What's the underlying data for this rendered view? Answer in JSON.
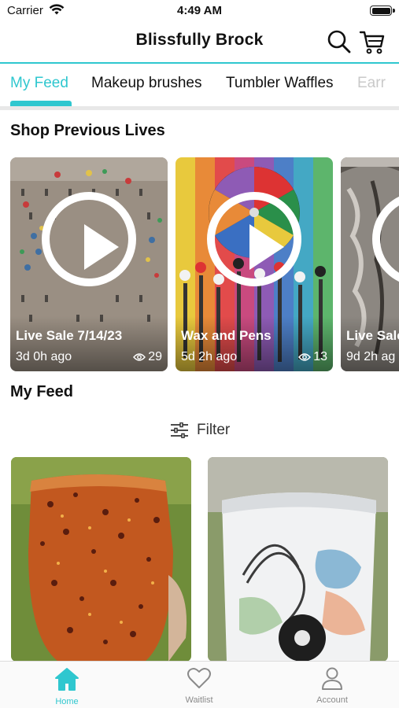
{
  "status_bar": {
    "carrier": "Carrier",
    "time": "4:49 AM"
  },
  "header": {
    "title": "Blissfully Brock"
  },
  "tabs": [
    {
      "label": "My Feed"
    },
    {
      "label": "Makeup brushes"
    },
    {
      "label": "Tumbler Waffles"
    },
    {
      "label": "Earr"
    }
  ],
  "previous_lives": {
    "title": "Shop Previous Lives",
    "items": [
      {
        "name": "Live Sale 7/14/23",
        "age": "3d 0h ago",
        "views": "29"
      },
      {
        "name": "Wax and Pens",
        "age": "5d 2h ago",
        "views": "13"
      },
      {
        "name": "Live Sale",
        "age": "9d 2h ag",
        "views": ""
      }
    ]
  },
  "feed": {
    "title": "My Feed",
    "filter_label": "Filter"
  },
  "bottom_nav": [
    {
      "label": "Home"
    },
    {
      "label": "Waitlist"
    },
    {
      "label": "Account"
    }
  ],
  "colors": {
    "accent": "#2fc7cf",
    "text": "#111111",
    "inactive": "#8a8a8a"
  }
}
